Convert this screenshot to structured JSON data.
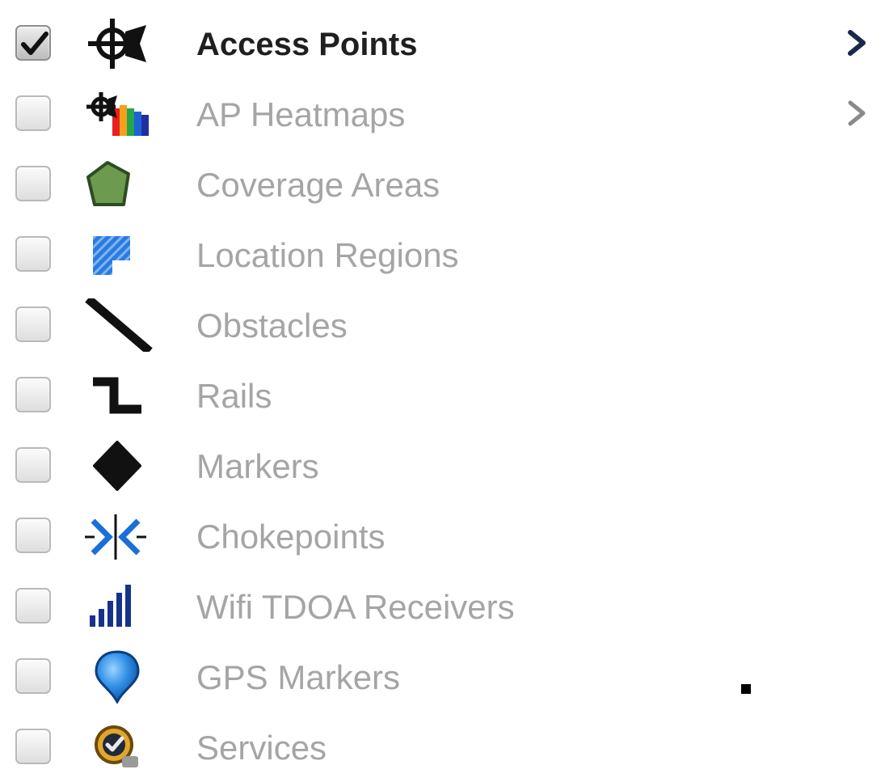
{
  "layers": [
    {
      "label": "Access Points",
      "checked": true,
      "icon": "access-point-icon",
      "has_submenu": true
    },
    {
      "label": "AP Heatmaps",
      "checked": false,
      "icon": "heatmap-icon",
      "has_submenu": true
    },
    {
      "label": "Coverage Areas",
      "checked": false,
      "icon": "coverage-area-icon",
      "has_submenu": false
    },
    {
      "label": "Location Regions",
      "checked": false,
      "icon": "location-region-icon",
      "has_submenu": false
    },
    {
      "label": "Obstacles",
      "checked": false,
      "icon": "obstacle-icon",
      "has_submenu": false
    },
    {
      "label": "Rails",
      "checked": false,
      "icon": "rail-icon",
      "has_submenu": false
    },
    {
      "label": "Markers",
      "checked": false,
      "icon": "marker-icon",
      "has_submenu": false
    },
    {
      "label": "Chokepoints",
      "checked": false,
      "icon": "chokepoint-icon",
      "has_submenu": false
    },
    {
      "label": "Wifi TDOA Receivers",
      "checked": false,
      "icon": "signal-bars-icon",
      "has_submenu": false
    },
    {
      "label": "GPS Markers",
      "checked": false,
      "icon": "map-pin-icon",
      "has_submenu": false
    },
    {
      "label": "Services",
      "checked": false,
      "icon": "services-icon",
      "has_submenu": false
    }
  ],
  "colors": {
    "active_text": "#1f1f1f",
    "inactive_text": "#a5a5a5",
    "chevron_active": "#1b2a4a",
    "chevron_inactive": "#8a8a8a"
  }
}
